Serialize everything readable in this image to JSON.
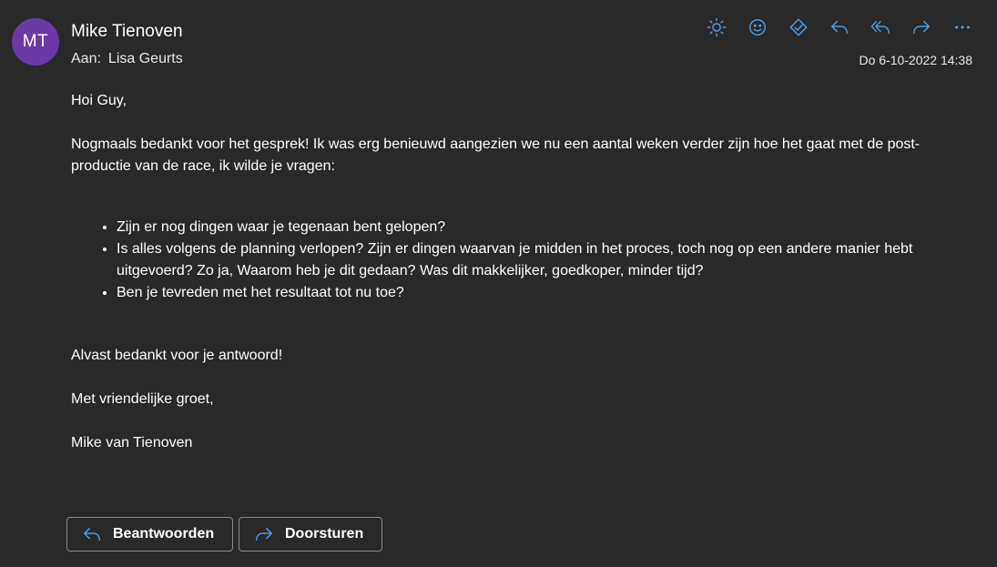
{
  "header": {
    "avatar_initials": "MT",
    "avatar_color": "#6b3aa6",
    "sender_name": "Mike Tienoven",
    "to_label": "Aan:",
    "to_name": "Lisa Geurts",
    "date": "Do 6-10-2022 14:38"
  },
  "toolbar": {
    "icon_color": "#4aa3f0",
    "icons": [
      "sun-icon",
      "smiley-icon",
      "tag-icon",
      "reply-icon",
      "reply-all-icon",
      "forward-icon",
      "more-icon"
    ]
  },
  "message": {
    "greeting": "Hoi Guy,",
    "intro": "Nogmaals bedankt voor het gesprek! Ik was erg benieuwd aangezien we nu een aantal weken verder zijn hoe het gaat met de post-productie van de race, ik wilde je vragen:",
    "questions": [
      "Zijn er nog dingen waar je tegenaan bent gelopen?",
      "Is alles volgens de planning verlopen? Zijn er dingen waarvan je midden in het proces, toch nog op een andere manier hebt uitgevoerd? Zo ja, Waarom heb je dit gedaan? Was dit makkelijker, goedkoper, minder tijd?",
      "Ben je tevreden met het resultaat tot nu toe?"
    ],
    "thanks": "Alvast bedankt voor je antwoord!",
    "closing": "Met vriendelijke groet,",
    "signature": "Mike van Tienoven"
  },
  "actions": {
    "reply_label": "Beantwoorden",
    "forward_label": "Doorsturen"
  }
}
